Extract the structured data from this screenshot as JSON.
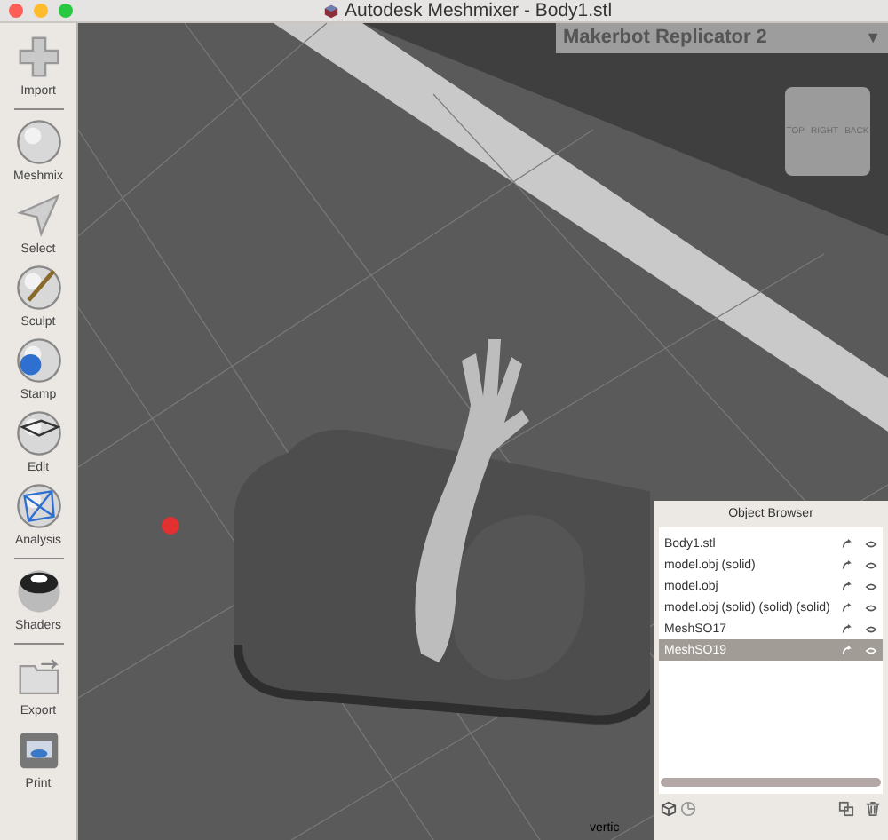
{
  "window": {
    "title": "Autodesk Meshmixer - Body1.stl"
  },
  "tool_groups": [
    [
      "Import"
    ],
    [
      "Meshmix",
      "Select",
      "Sculpt",
      "Stamp",
      "Edit",
      "Analysis"
    ],
    [
      "Shaders"
    ],
    [
      "Export",
      "Print"
    ]
  ],
  "printer_dropdown": {
    "value": "Makerbot Replicator 2",
    "caret": "▼"
  },
  "view_cube": {
    "faces": [
      "TOP",
      "RIGHT",
      "BACK"
    ]
  },
  "object_browser": {
    "title": "Object Browser",
    "objects": [
      {
        "name": "Body1.stl",
        "selected": false
      },
      {
        "name": "model.obj (solid)",
        "selected": false
      },
      {
        "name": "model.obj",
        "selected": false
      },
      {
        "name": "model.obj (solid) (solid) (solid)",
        "selected": false
      },
      {
        "name": "MeshSO17",
        "selected": false
      },
      {
        "name": "MeshSO19",
        "selected": true
      }
    ]
  },
  "status_text": "vertic"
}
